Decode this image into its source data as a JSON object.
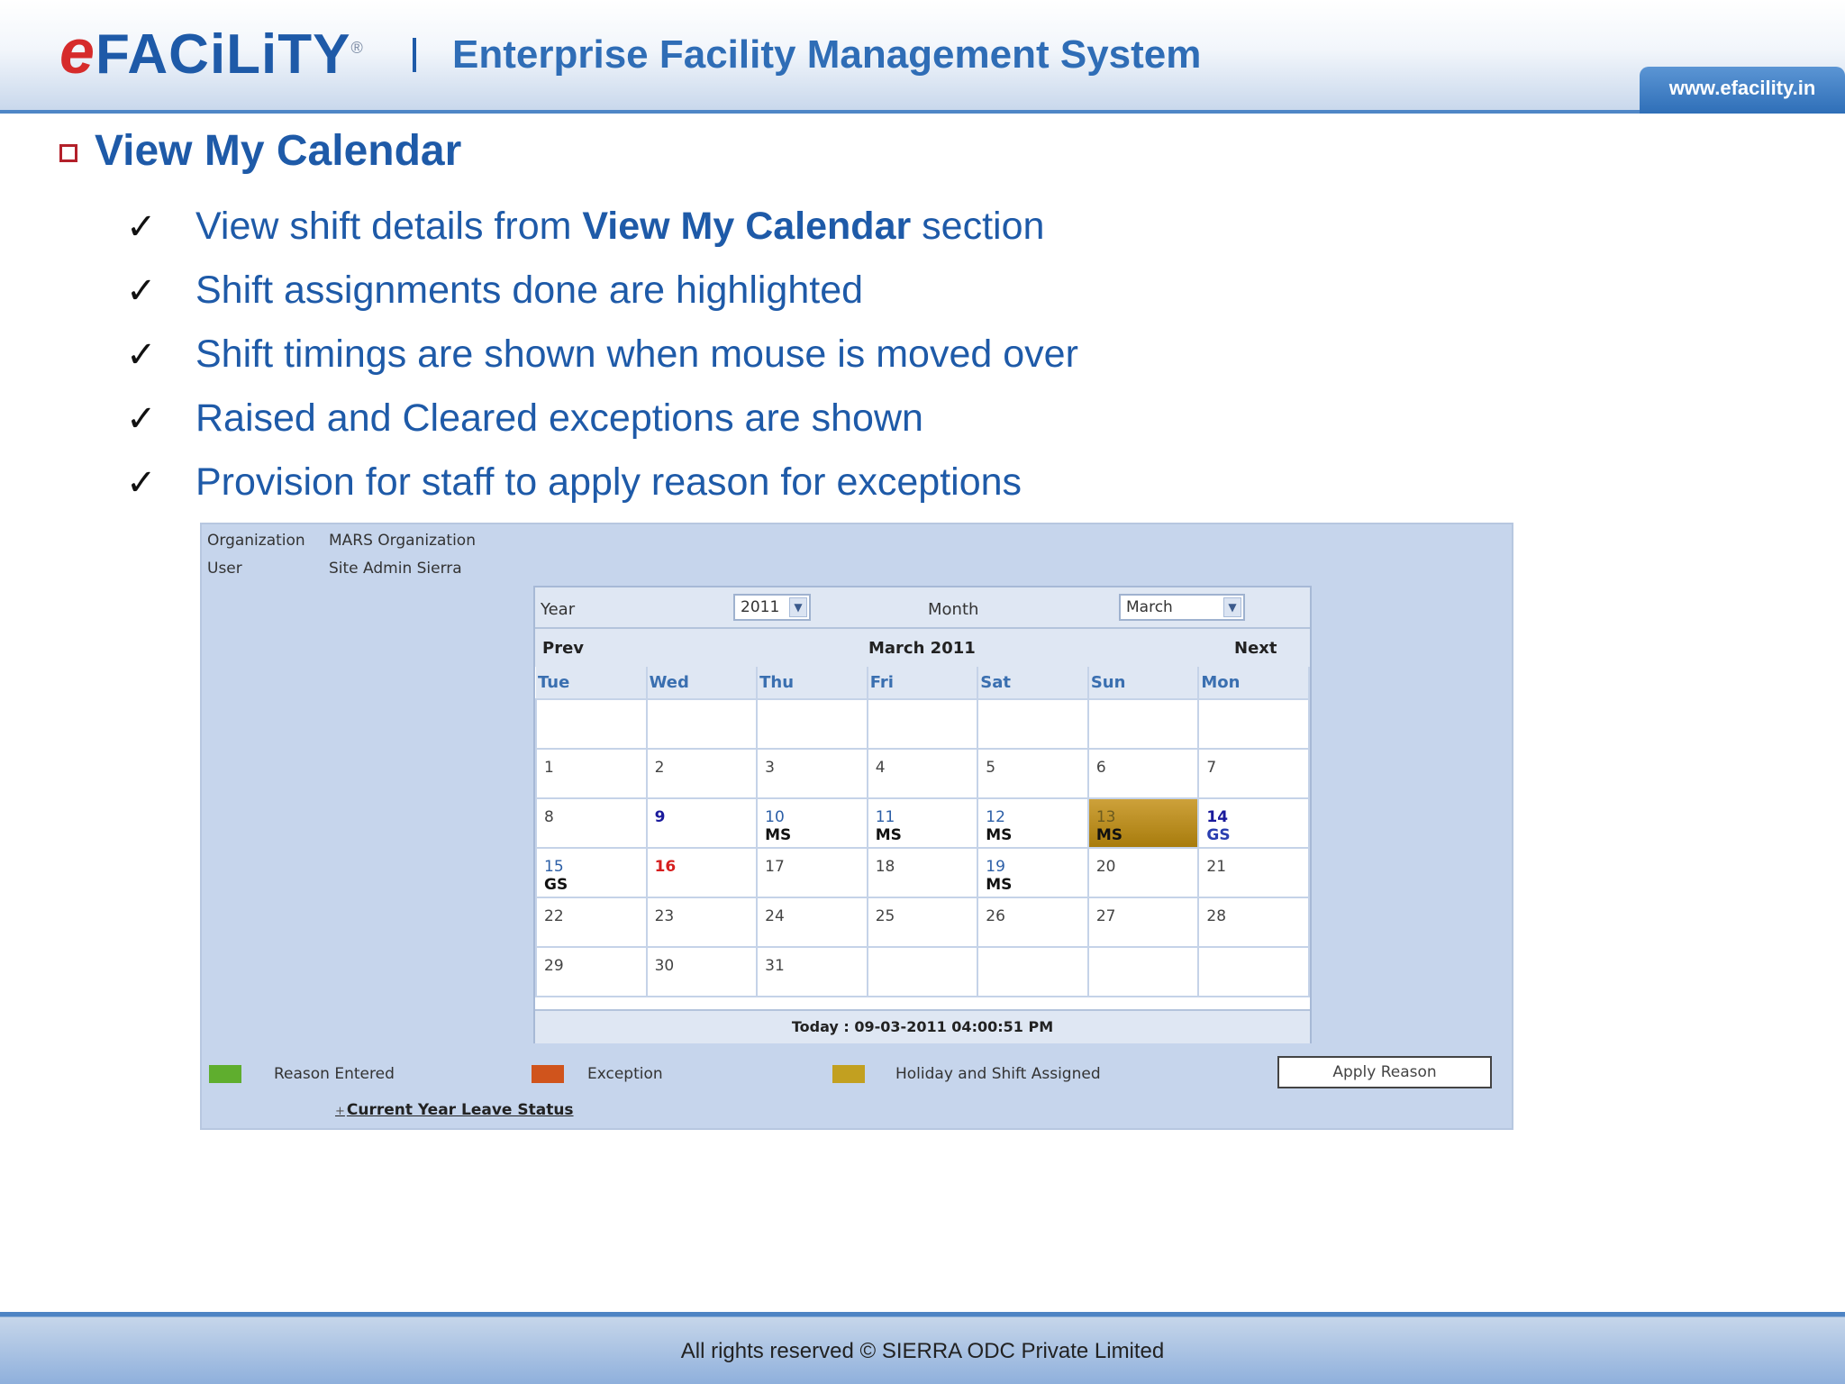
{
  "header": {
    "logo_first": "e",
    "logo_rest": "FACiLiTY",
    "logo_reg": "®",
    "title": "Enterprise Facility Management System",
    "url": "www.efacility.in"
  },
  "slide": {
    "title": "View My Calendar",
    "points": [
      {
        "pre": "View shift details from ",
        "bold": "View My Calendar",
        "post": " section"
      },
      {
        "pre": "Shift assignments done are highlighted",
        "bold": "",
        "post": ""
      },
      {
        "pre": "Shift timings are shown when mouse is moved over",
        "bold": "",
        "post": ""
      },
      {
        "pre": "Raised and Cleared exceptions are shown",
        "bold": "",
        "post": ""
      },
      {
        "pre": "Provision for staff to apply reason for exceptions",
        "bold": "",
        "post": ""
      }
    ],
    "check_glyph": "✓"
  },
  "screen": {
    "org_label": "Organization",
    "org_value": "MARS Organization",
    "user_label": "User",
    "user_value": "Site Admin Sierra",
    "year_label": "Year",
    "year_value": "2011",
    "month_label": "Month",
    "month_value": "March",
    "prev": "Prev",
    "heading": "March 2011",
    "next": "Next",
    "days": [
      "Tue",
      "Wed",
      "Thu",
      "Fri",
      "Sat",
      "Sun",
      "Mon"
    ],
    "weeks": [
      [
        {
          "d": ""
        },
        {
          "d": ""
        },
        {
          "d": ""
        },
        {
          "d": ""
        },
        {
          "d": ""
        },
        {
          "d": ""
        },
        {
          "d": ""
        }
      ],
      [
        {
          "d": "1"
        },
        {
          "d": "2"
        },
        {
          "d": "3"
        },
        {
          "d": "4"
        },
        {
          "d": "5"
        },
        {
          "d": "6"
        },
        {
          "d": "7"
        }
      ],
      [
        {
          "d": "8"
        },
        {
          "d": "9"
        },
        {
          "d": "10",
          "s": "MS"
        },
        {
          "d": "11",
          "s": "MS"
        },
        {
          "d": "12",
          "s": "MS"
        },
        {
          "d": "13",
          "s": "MS"
        },
        {
          "d": "14",
          "s": "GS"
        }
      ],
      [
        {
          "d": "15",
          "s": "GS"
        },
        {
          "d": "16"
        },
        {
          "d": "17"
        },
        {
          "d": "18"
        },
        {
          "d": "19",
          "s": "MS"
        },
        {
          "d": "20"
        },
        {
          "d": "21"
        }
      ],
      [
        {
          "d": "22"
        },
        {
          "d": "23"
        },
        {
          "d": "24"
        },
        {
          "d": "25"
        },
        {
          "d": "26"
        },
        {
          "d": "27"
        },
        {
          "d": "28"
        }
      ],
      [
        {
          "d": "29"
        },
        {
          "d": "30"
        },
        {
          "d": "31"
        },
        {
          "d": ""
        },
        {
          "d": ""
        },
        {
          "d": ""
        },
        {
          "d": ""
        }
      ]
    ],
    "today": "Today : 09-03-2011 04:00:51 PM",
    "legend": [
      {
        "label": "Reason Entered",
        "color": "#5fae2e"
      },
      {
        "label": "Exception",
        "color": "#d0541c"
      },
      {
        "label": "Holiday and Shift Assigned",
        "color": "#c2a020"
      }
    ],
    "apply_button": "Apply Reason",
    "leave_link": "Current Year Leave Status",
    "leave_plus": "+"
  },
  "footer": {
    "text": "All rights reserved © SIERRA ODC Private Limited"
  },
  "colors": {
    "brand_blue": "#1e5aa8",
    "logo_red": "#d62b2b",
    "highlight_gold": "#b88a18"
  }
}
